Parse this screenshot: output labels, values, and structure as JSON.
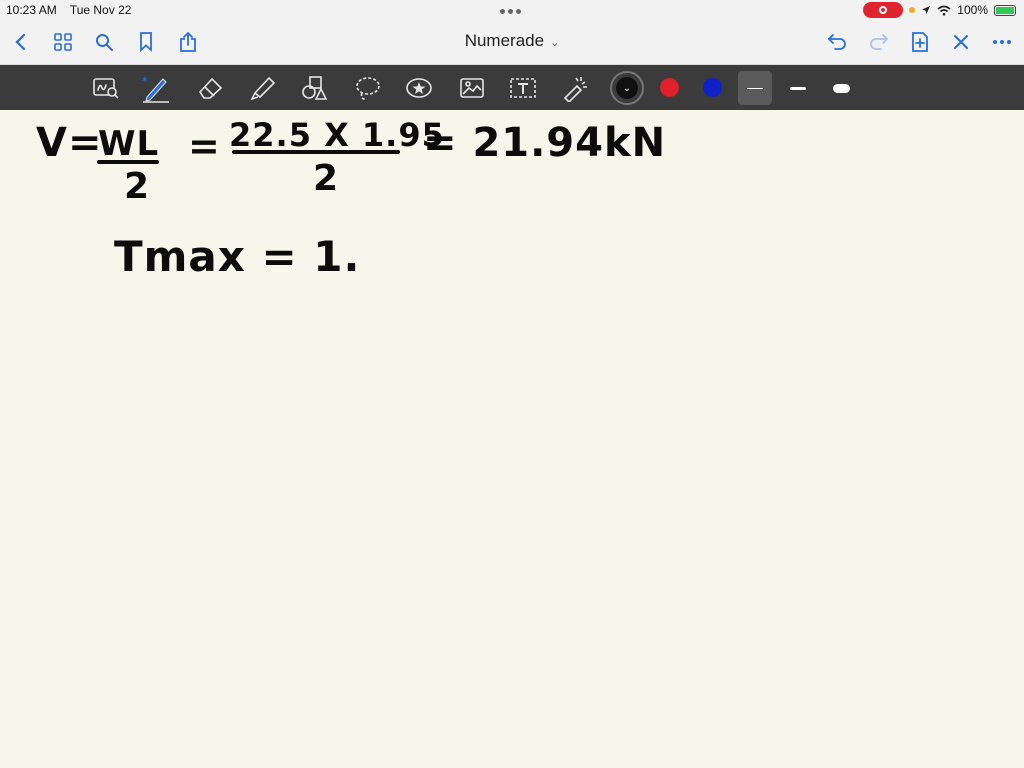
{
  "status_bar": {
    "time": "10:23 AM",
    "date": "Tue Nov 22",
    "battery": "100%"
  },
  "nav": {
    "title": "Numerade"
  },
  "toolbar": {
    "colors": [
      "#111111",
      "#e0202a",
      "#1020c8"
    ],
    "selected_color_index": 0
  },
  "notes": {
    "eq1_lhs": "V=",
    "eq1_num1": "WL",
    "eq1_den1": "2",
    "eq1_eq2": "=",
    "eq1_num2": "22.5 X 1.95",
    "eq1_den2": "2",
    "eq1_result": "= 21.94kN",
    "eq2": "Tmax = 1."
  }
}
